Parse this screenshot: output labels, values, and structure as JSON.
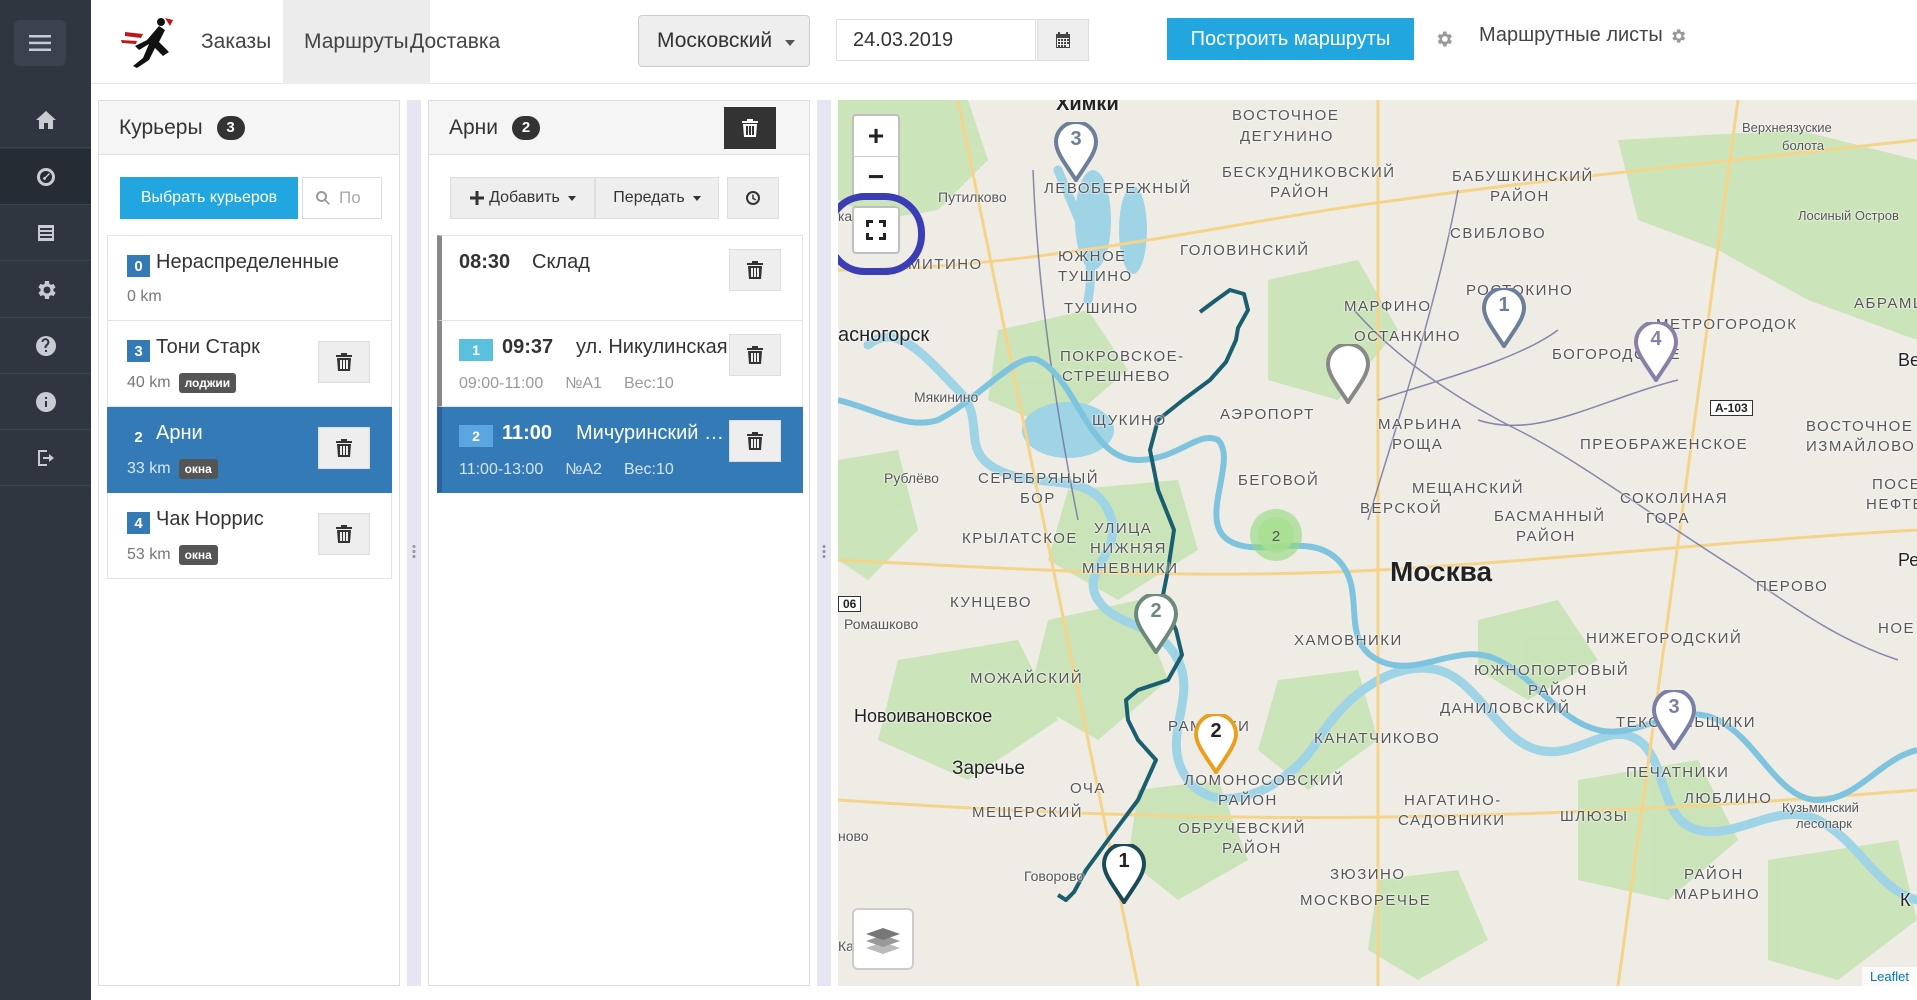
{
  "sidebar": {
    "items": [
      "menu-icon",
      "home-icon",
      "dashboard-icon",
      "list-icon",
      "gear-icon",
      "help-icon",
      "info-icon",
      "logout-icon"
    ]
  },
  "topbar": {
    "tabs": [
      {
        "label": "Заказы",
        "active": false
      },
      {
        "label": "Маршруты",
        "active": true
      },
      {
        "label": "Доставка",
        "active": false
      }
    ],
    "region": "Московский",
    "date": "24.03.2019",
    "build_label": "Построить маршруты",
    "sheets_label": "Маршрутные листы",
    "accent": "#21a6e0"
  },
  "couriers": {
    "title": "Курьеры",
    "count": "3",
    "select_label": "Выбрать курьеров",
    "search_placeholder": "По",
    "items": [
      {
        "num": "0",
        "name": "Нераспределенные",
        "dist": "0 km",
        "tag": ""
      },
      {
        "num": "3",
        "name": "Тони Старк",
        "dist": "40 km",
        "tag": "лоджии"
      },
      {
        "num": "2",
        "name": "Арни",
        "dist": "33 km",
        "tag": "окна"
      },
      {
        "num": "4",
        "name": "Чак Норрис",
        "dist": "53 km",
        "tag": "окна"
      }
    ]
  },
  "route": {
    "title": "Арни",
    "count": "2",
    "add_label": "Добавить",
    "transfer_label": "Передать",
    "stops": [
      {
        "num": "",
        "time": "08:30",
        "addr": "Склад",
        "window": "",
        "order": "",
        "weight": ""
      },
      {
        "num": "1",
        "time": "09:37",
        "addr": "ул. Никулинская",
        "window": "09:00-11:00",
        "order": "№A1",
        "weight": "Вес:10"
      },
      {
        "num": "2",
        "time": "11:00",
        "addr": "Мичуринский проспект",
        "window": "11:00-13:00",
        "order": "№A2",
        "weight": "Вес:10"
      }
    ]
  },
  "map": {
    "zoom_in": "+",
    "zoom_out": "−",
    "attribution": "Leaflet",
    "labels": {
      "khimki": "Химки",
      "vost_degunino": "ВОСТОЧНОЕ",
      "vost_degunino2": "ДЕГУНИНО",
      "beskud": "БЕСКУДНИКОВСКИЙ",
      "beskud2": "РАЙОН",
      "babush": "БАБУШКИНСКИЙ",
      "babush2": "РАЙОН",
      "verkh_bol": "Верхнеязуские",
      "verkh_bol2": "болота",
      "losiny": "Лосиный Остров",
      "putilkovo": "Путилково",
      "levob": "ЛЕВОБЕРЕЖНЫЙ",
      "sviblovo": "СВИБЛОВО",
      "yuzh_tush": "ЮЖНОЕ",
      "yuzh_tush2": "ТУШИНО",
      "golov": "ГОЛОВИНСКИЙ",
      "rostokino": "РОСТОКИНО",
      "abramts": "АБРАМЦ",
      "tushino": "ТУШИНО",
      "marfino": "МАРФИНО",
      "metrogorod": "МЕТРОГОРОДОК",
      "krasnogorsk": "асногорск",
      "ostankino": "ОСТАНКИНО",
      "bogorod": "БОГОРОДСКОЕ",
      "pokr": "ПОКРОВСКОЕ-",
      "pokr2": "СТРЕШНЕВО",
      "myakinino": "Мякинино",
      "a103": "А-103",
      "aeroport": "АЭРОПОРТ",
      "marina": "МАРЬИНА",
      "marina2": "РОЩА",
      "vost_izm": "ВОСТОЧНОЕ",
      "vost_izm2": "ИЗМАЙЛОВО",
      "shchukino": "ЩУКИНО",
      "preobr": "ПРЕОБРАЖЕНСКОЕ",
      "rublevo": "Рублёво",
      "sereb": "СЕРЕБРЯНЫЙ",
      "sereb2": "БОР",
      "begovoy": "БЕГОВОЙ",
      "meshch": "МЕЩАНСКИЙ",
      "tverskoy": "ВЕРСКОЙ",
      "sokol": "СОКОЛИНАЯ",
      "sokol2": "ГОРА",
      "basman": "БАСМАННЫЙ",
      "basman2": "РАЙОН",
      "krylat": "КРЫЛАТСКОЕ",
      "ulitsa": "УЛИЦА",
      "ulitsa2": "НИЖНЯЯ",
      "ulitsa3": "МНЕВНИКИ",
      "moskva": "Москва",
      "kuntsevo": "КУНЦЕВО",
      "perovo": "ПЕРОВО",
      "romashkovo": "Ромашково",
      "khamov": "ХАМОВНИКИ",
      "nizhegor": "НИЖЕГОРОДСКИЙ",
      "mozhay": "МОЖАЙСКИЙ",
      "yuzhport": "ЮЖНОПОРТОВЫЙ",
      "yuzhport2": "РАЙОН",
      "danil": "ДАНИЛОВСКИЙ",
      "novoiv": "Новоивановское",
      "tekst": "ТЕКСТИЛЬЩИКИ",
      "ramenki": "РАМЕНКИ",
      "kanat": "КАНАТЧИКОВО",
      "zarechye": "Заречье",
      "lomon": "ЛОМОНОСОВСКИЙ",
      "lomon2": "РАЙОН",
      "pechat": "ПЕЧАТНИКИ",
      "ochak": "ОЧА",
      "nagat": "НАГАТИНО-",
      "nagat2": "САДОВНИКИ",
      "shlyuzy": "ШЛЮЗЫ",
      "lyublino": "ЛЮБЛИНО",
      "kuzm": "Кузьминский",
      "kuzm2": "лесопарк",
      "meshcher": "МЕЩЕРСКИЙ",
      "obruch": "ОБРУЧЕВСКИЙ",
      "obruch2": "РАЙОН",
      "zyuzino": "ЗЮЗИНО",
      "marino": "РАЙОН",
      "marino2": "МАРЬИНО",
      "govorovo": "Говорово",
      "moskvorech": "МОСКВОРЕЧЬЕ",
      "road06": "06",
      "ka": "ка",
      "mitino": "МИТИНО",
      "be": "Ве",
      "pe": "Ре",
      "pose": "ПОСЕ",
      "nefte": "НЕФТЕ",
      "noe": "НОЕ",
      "nobo": "ново",
      "ka2": "Ка",
      "kuzm_edge": "К"
    },
    "pins": [
      {
        "num": "3",
        "color": "#6b7f9a"
      },
      {
        "num": "1",
        "color": "#6b7f9a"
      },
      {
        "num": "4",
        "color": "#8a7fa8"
      },
      {
        "num": "",
        "color": "#888888"
      },
      {
        "num": "2",
        "color": "#6b8a7a"
      },
      {
        "num": "2",
        "color": "#e8a020"
      },
      {
        "num": "3",
        "color": "#7a7fa8"
      },
      {
        "num": "1",
        "color": "#1a4a5a"
      }
    ],
    "cluster": "2",
    "route_color": "#1a5f6f"
  }
}
